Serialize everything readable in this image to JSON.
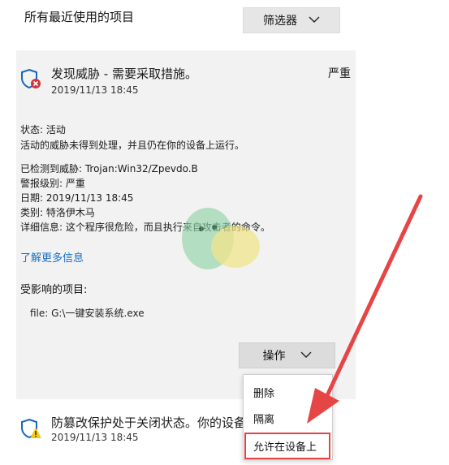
{
  "header": {
    "title": "所有最近使用的项目",
    "filter_label": "筛选器"
  },
  "threat": {
    "title": "发现威胁 - 需要采取措施。",
    "severity": "严重",
    "date": "2019/11/13 18:45",
    "status_line": "状态: 活动",
    "status_desc": "活动的威胁未得到处理，并且仍在你的设备上运行。",
    "detected_line": "已检测到威胁: Trojan:Win32/Zpevdo.B",
    "alert_level_line": "警报级别: 严重",
    "date_line": "日期: 2019/11/13 18:45",
    "category_line": "类别: 特洛伊木马",
    "details_line": "详细信息: 这个程序很危险，而且执行来自攻击者的命令。",
    "learn_more": "了解更多信息",
    "affected_title": "受影响的项目:",
    "file_line": "file: G:\\一键安装系统.exe"
  },
  "actions": {
    "button_label": "操作",
    "menu_items": [
      "删除",
      "隔离",
      "允许在设备上"
    ]
  },
  "row2": {
    "title": "防篡改保护处于关闭状态。你的设备",
    "date": "2019/11/13 18:45"
  },
  "icons": {
    "threat": "shield-threat-icon",
    "warning": "shield-warning-icon",
    "chevron": "chevron-down-icon"
  },
  "colors": {
    "shield_blue": "#1565c0",
    "threat_red": "#d13438",
    "warning_yellow": "#f2c811",
    "link_blue": "#1a6ec2",
    "highlight_red": "#e64545"
  }
}
